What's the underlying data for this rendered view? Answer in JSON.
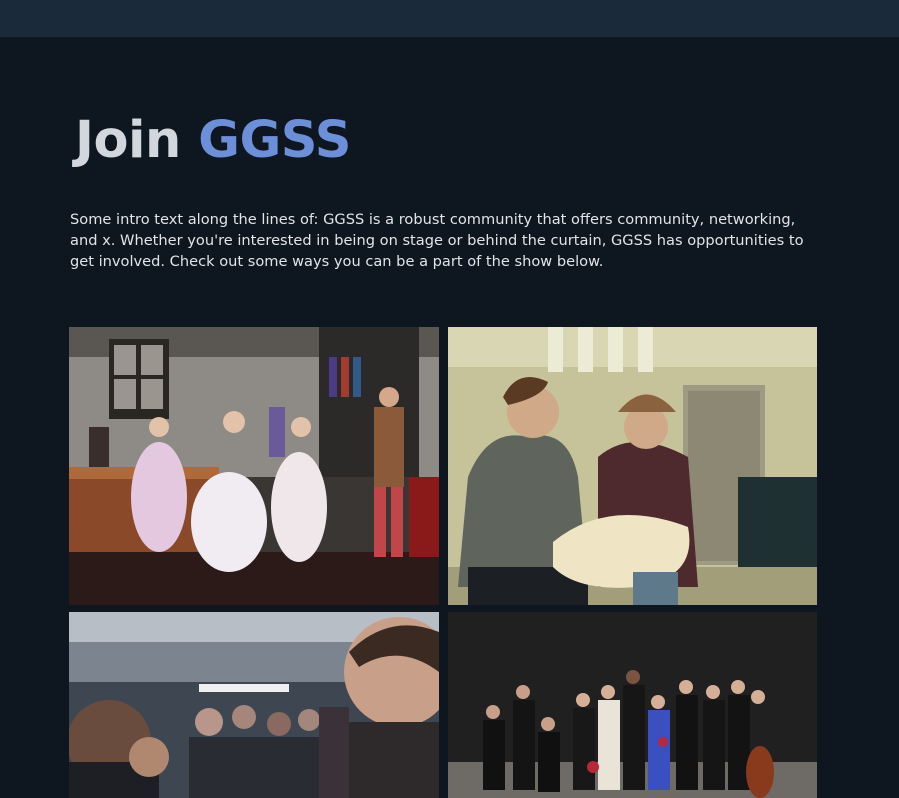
{
  "header": {
    "title_word1": "Join",
    "title_word2": "GGSS"
  },
  "intro": {
    "text": "Some intro text along the lines of:  GGSS is a robust community that offers community, networking, and x. Whether you're interested in being on stage or behind the curtain, GGSS has opportunities to get involved. Check out some ways you can be a part of the show below."
  },
  "colors": {
    "background": "#0e161f",
    "top_bar": "#1b2a3b",
    "accent": "#6d8fd9",
    "heading_text": "#d2d7dd"
  },
  "gallery": {
    "photos": [
      {
        "name": "stage-performance-photo",
        "subject": "costumed cast dancing on stage"
      },
      {
        "name": "backstage-costume-photo",
        "subject": "two people working on a costume backstage"
      },
      {
        "name": "audience-crowd-photo",
        "subject": "crowd of people in a hallway"
      },
      {
        "name": "orchestra-cast-photo",
        "subject": "cast and orchestra group on dark stage"
      }
    ]
  }
}
